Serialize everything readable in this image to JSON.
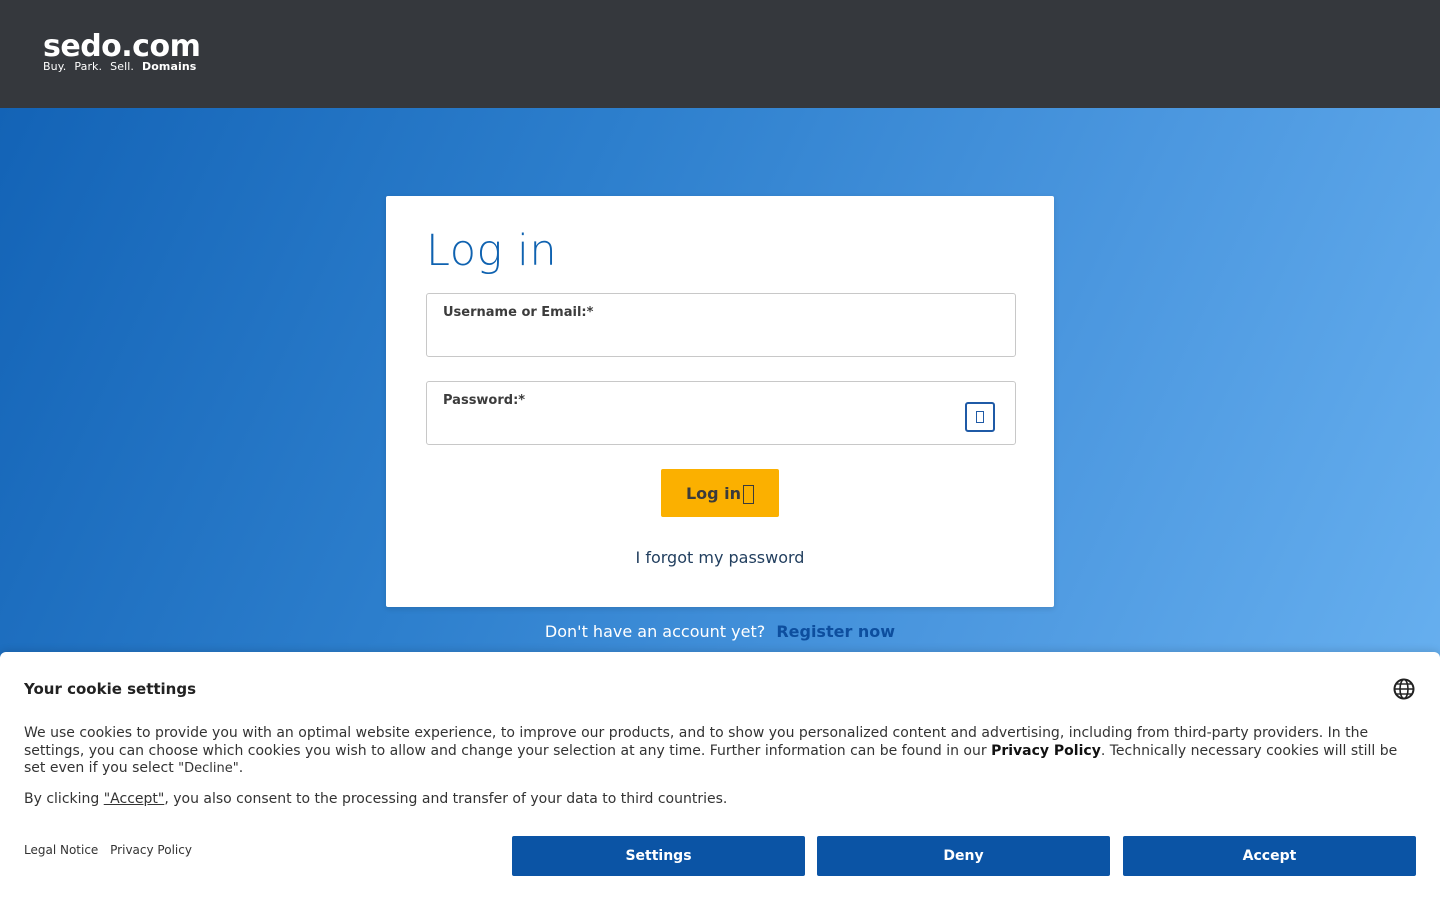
{
  "header": {
    "logo_main": "sedo.com",
    "logo_tagline": [
      "Buy.",
      "Park.",
      "Sell.",
      "Domains"
    ]
  },
  "login": {
    "title": "Log in",
    "username_label": "Username or Email:*",
    "username_value": "",
    "password_label": "Password:*",
    "password_value": "",
    "show_password_icon": "eye-icon",
    "submit_label": "Log in",
    "submit_icon": "arrow-right-icon",
    "forgot_link": "I forgot my password"
  },
  "register": {
    "prompt": "Don't have an account yet?",
    "link": "Register now"
  },
  "cookie": {
    "title": "Your cookie settings",
    "language_icon": "globe-icon",
    "text_part1": "We use cookies to provide you with an optimal website experience, to improve our products, and to show you personalized content and advertising, including from third-party providers. In the settings, you can choose which cookies you wish to allow and change your selection at any time. Further information can be found in our ",
    "privacy_bold": "Privacy Policy",
    "text_part2": ". Technically necessary cookies will still be set even if you select ",
    "decline_ref": "\"Decline\"",
    "text_part3": ".",
    "consent_part1": "By clicking ",
    "consent_accept_ref": "\"Accept\"",
    "consent_part2": ", you also consent to the processing and transfer of your data to third countries.",
    "footer_links": [
      "Legal Notice",
      "Privacy Policy"
    ],
    "buttons": {
      "settings": "Settings",
      "deny": "Deny",
      "accept": "Accept"
    }
  },
  "colors": {
    "topbar": "#35383d",
    "accent_yellow": "#fbb000",
    "button_blue": "#0b54a5",
    "title_blue": "#0f62b0"
  }
}
